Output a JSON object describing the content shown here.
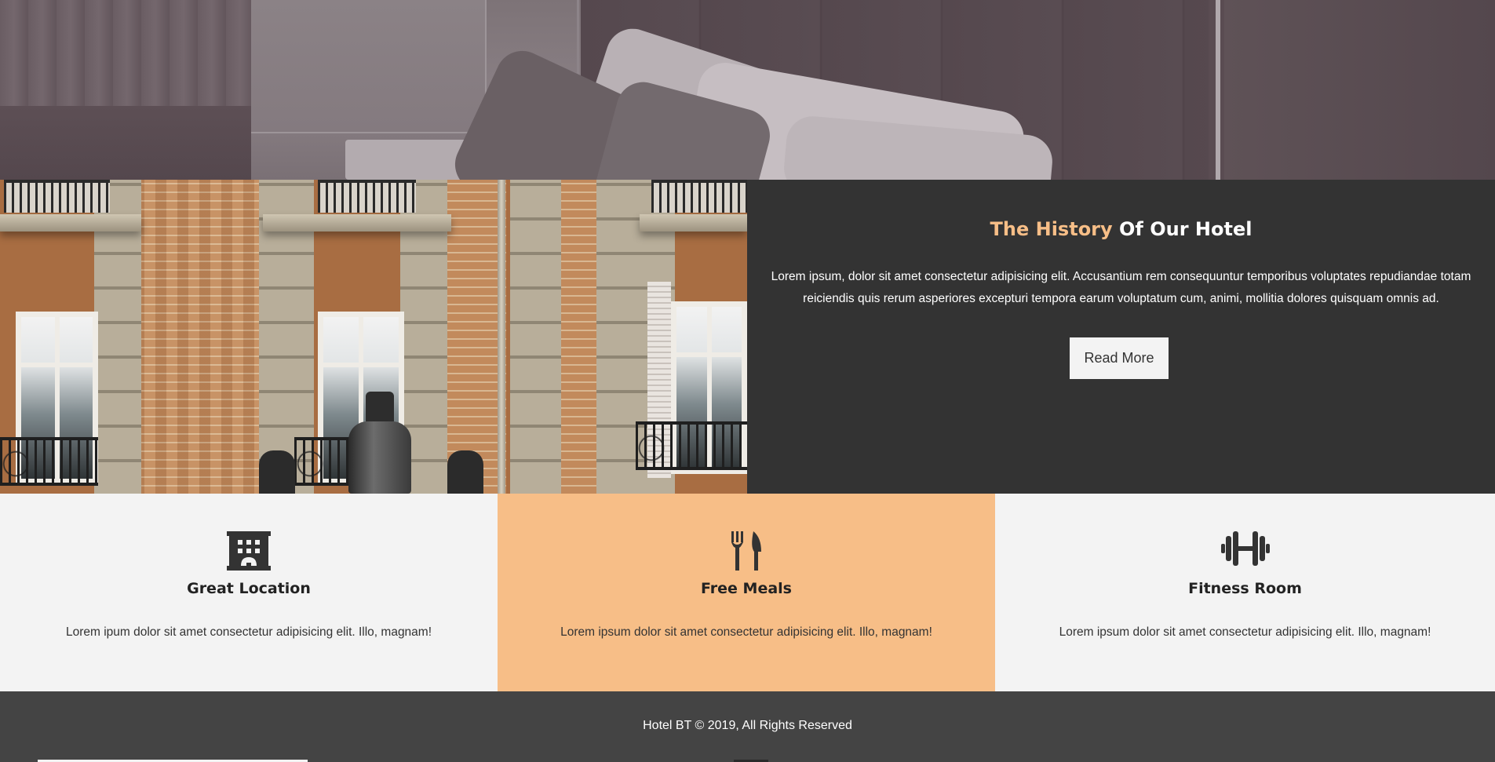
{
  "history": {
    "title_accent": "The History",
    "title_rest": "Of Our Hotel",
    "text": "Lorem ipsum, dolor sit amet consectetur adipisicing elit. Accusantium rem consequuntur temporibus voluptates repudiandae totam reiciendis quis rerum asperiores excepturi tempora earum voluptatum cum, animi, mollitia dolores quisquam omnis ad.",
    "button_label": "Read More"
  },
  "features": [
    {
      "icon": "building-icon",
      "title": "Great Location",
      "text": "Lorem ipum dolor sit amet consectetur adipisicing elit. Illo, magnam!"
    },
    {
      "icon": "utensils-icon",
      "title": "Free Meals",
      "text": "Lorem ipsum dolor sit amet consectetur adipisicing elit. Illo, magnam!"
    },
    {
      "icon": "dumbbell-icon",
      "title": "Fitness Room",
      "text": "Lorem ipsum dolor sit amet consectetur adipisicing elit. Illo, magnam!"
    }
  ],
  "footer": {
    "text": "Hotel BT © 2019, All Rights Reserved"
  },
  "colors": {
    "accent": "#f7be87",
    "dark": "#333333",
    "light": "#f3f3f3",
    "footer": "#444444"
  }
}
